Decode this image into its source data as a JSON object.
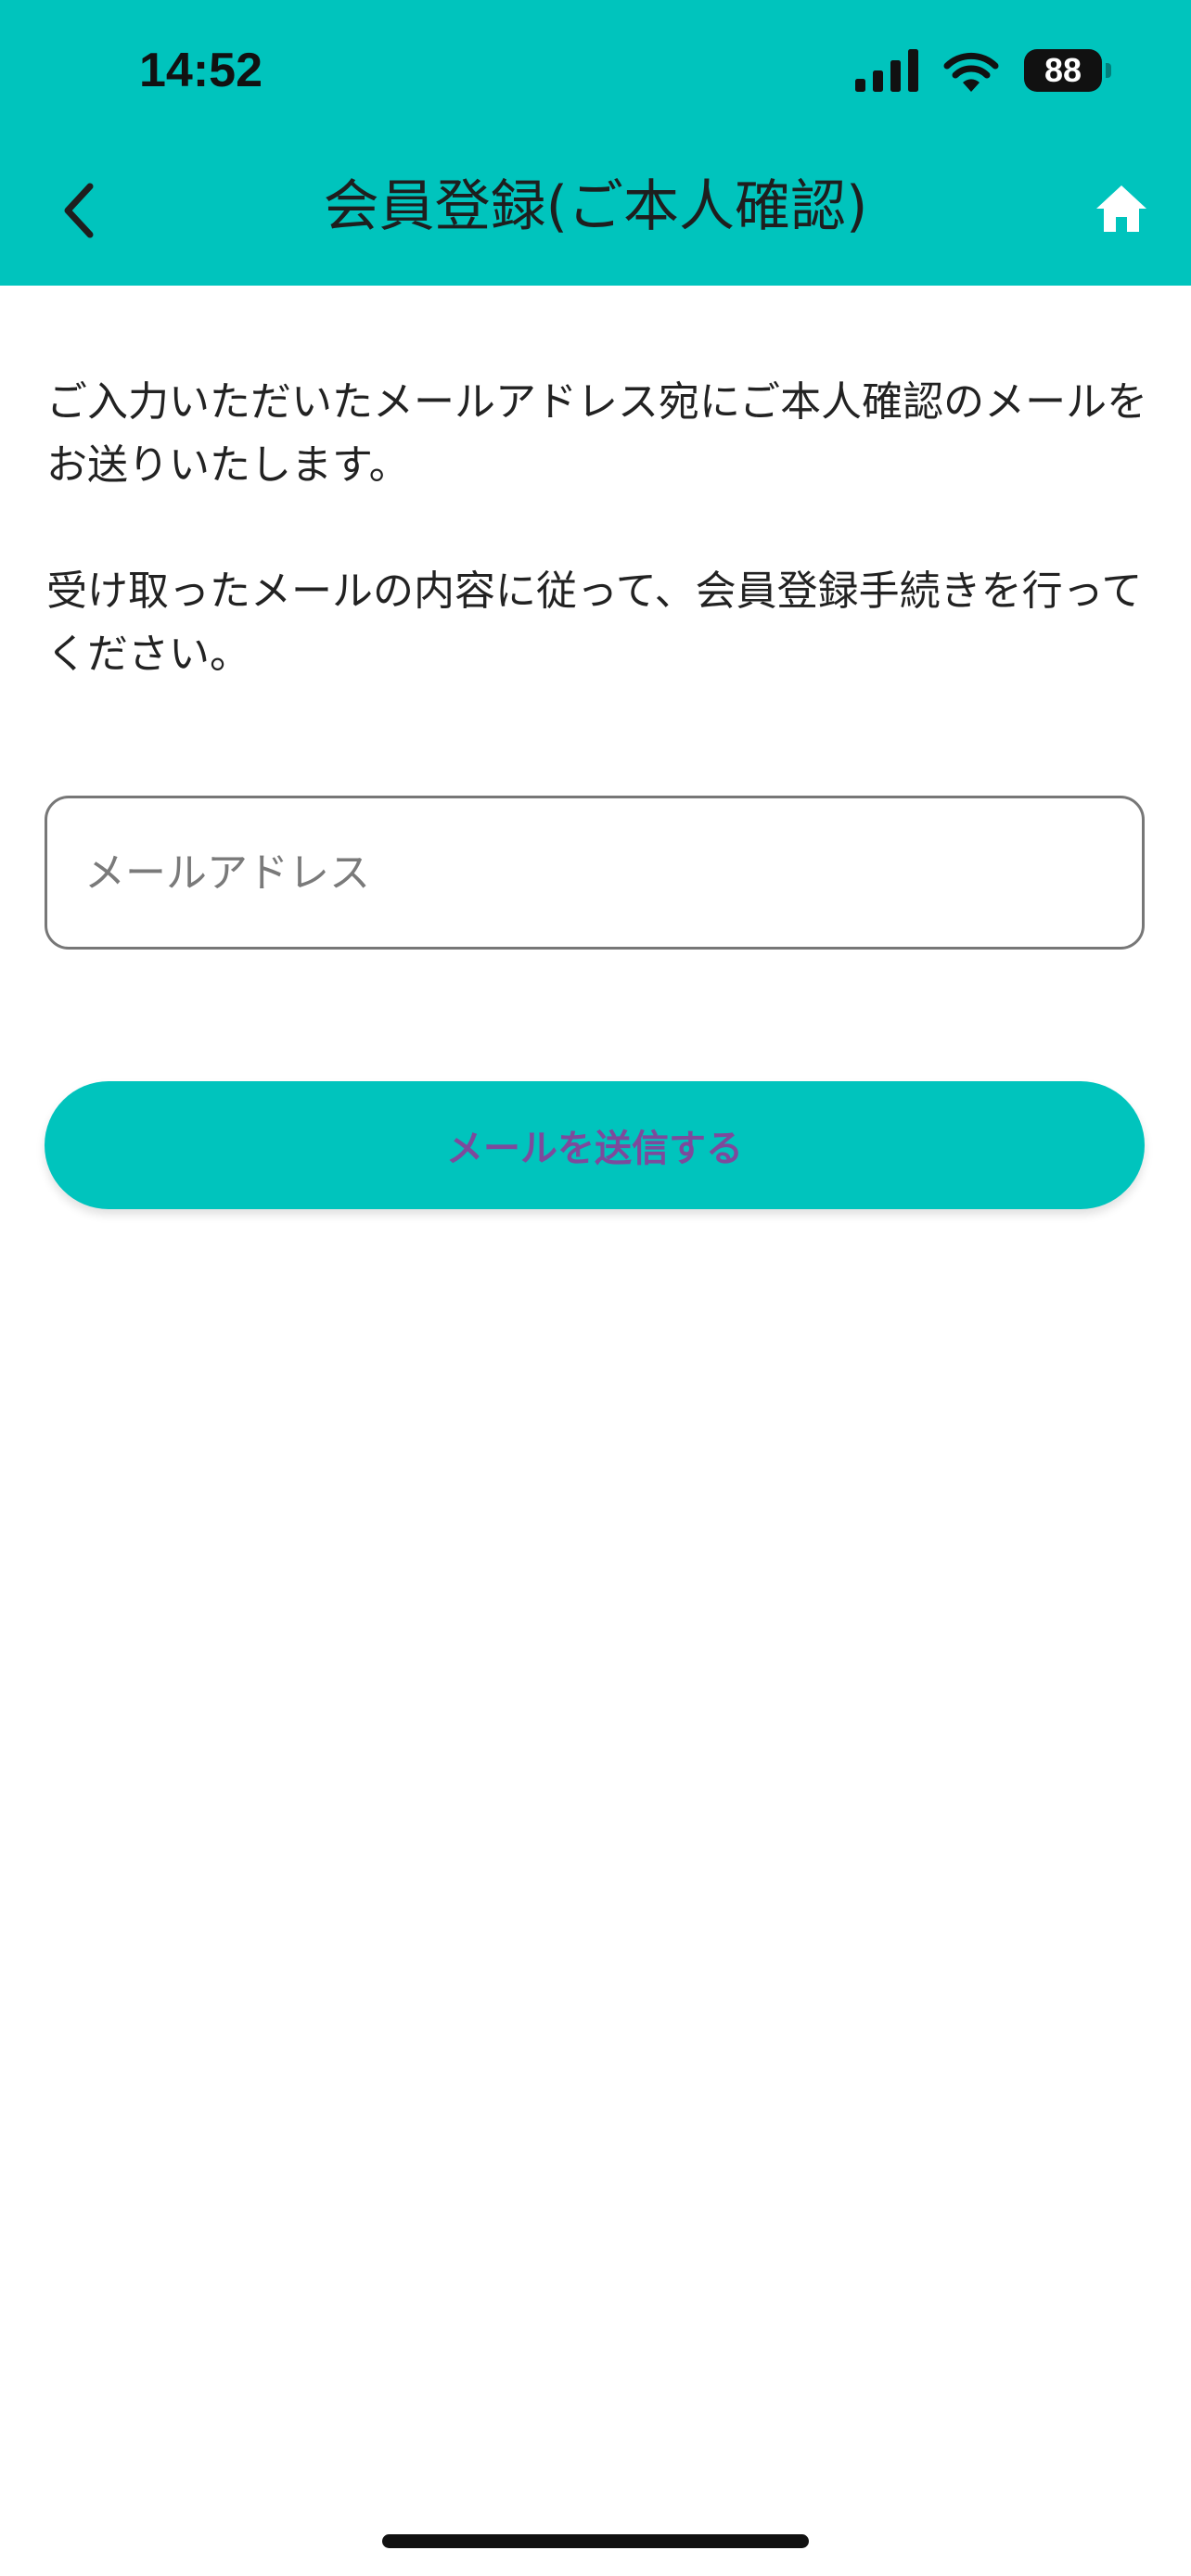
{
  "status_bar": {
    "time": "14:52",
    "battery": "88"
  },
  "nav": {
    "title": "会員登録(ご本人確認)",
    "back_icon": "chevron-left-icon",
    "home_icon": "home-icon"
  },
  "main": {
    "paragraph1": "ご入力いただいたメールアドレス宛にご本人確認のメールをお送りいたします。",
    "paragraph2": "受け取ったメールの内容に従って、会員登録手続きを行ってください。",
    "email_field": {
      "value": "",
      "placeholder": "メールアドレス"
    },
    "send_button_label": "メールを送信する"
  },
  "colors": {
    "accent": "#00c4bd",
    "button_text": "#7d4a9c"
  }
}
